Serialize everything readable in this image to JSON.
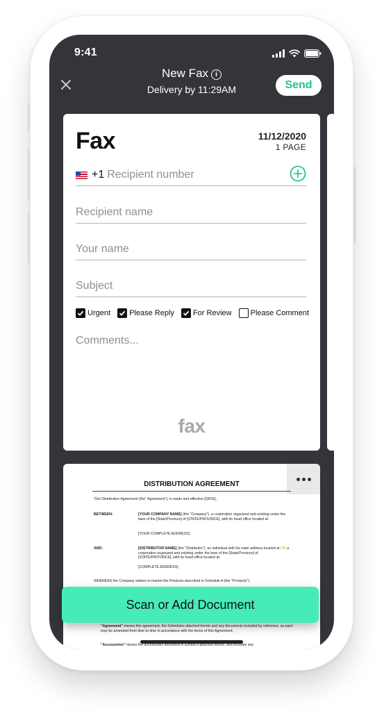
{
  "status_bar": {
    "time": "9:41"
  },
  "header": {
    "title": "New Fax",
    "subtitle": "Delivery by 11:29AM",
    "send_label": "Send"
  },
  "cover": {
    "heading": "Fax",
    "date": "11/12/2020",
    "pages": "1 PAGE",
    "country_code": "+1",
    "recipient_number_placeholder": "Recipient number",
    "recipient_name_placeholder": "Recipient name",
    "your_name_placeholder": "Your name",
    "subject_placeholder": "Subject",
    "checkboxes": [
      {
        "label": "Urgent",
        "checked": true
      },
      {
        "label": "Please Reply",
        "checked": true
      },
      {
        "label": "For Review",
        "checked": true
      },
      {
        "label": "Please Comment",
        "checked": false
      }
    ],
    "comments_placeholder": "Comments...",
    "logo_text": "fax"
  },
  "document": {
    "title": "DISTRIBUTION AGREEMENT",
    "intro": "This Distribution Agreement (the\" Agreement\"), is made and effective [DATE],",
    "between_label": "BETWEEN:",
    "between_bold": "[YOUR COMPANY NAME]",
    "between_text": "(the \"Company\"), a corporation organized and existing under the laws of the [State/Province] of [STATE/PROVINCE], with its head office located at:",
    "company_address": "[YOUR COMPLETE ADDRESS]",
    "and_label": "AND:",
    "and_bold": "[DISTRIBUTOR NAME]",
    "and_text_1": "(the \"Distributor\"), an individual with his main address located at",
    "and_or": "OR",
    "and_text_2": "a corporation organized and existing under the laws of the [State/Province] of [STATE/PROVINCE], with its head office located at:",
    "distributor_address": "[COMPLETE ADDRESS]",
    "whereas": "WHEREAS the Company wishes to market the Products described in Schedule A (the \"Products\")",
    "agreement_term": "\"Agreement\"",
    "agreement_def": "means this agreement, the Schedules attached hereto and any documents included by reference, as each may be amended from time to time in accordance with the terms of this Agreement;",
    "accessories_term": "\"Accessories\"",
    "accessories_def": "means the accessories described in Exhibit A attached hereto, and includes any"
  },
  "scan_button_label": "Scan or Add Document",
  "colors": {
    "accent": "#22c493",
    "scan_button": "#45ecba",
    "screen_bg": "#33353a"
  }
}
